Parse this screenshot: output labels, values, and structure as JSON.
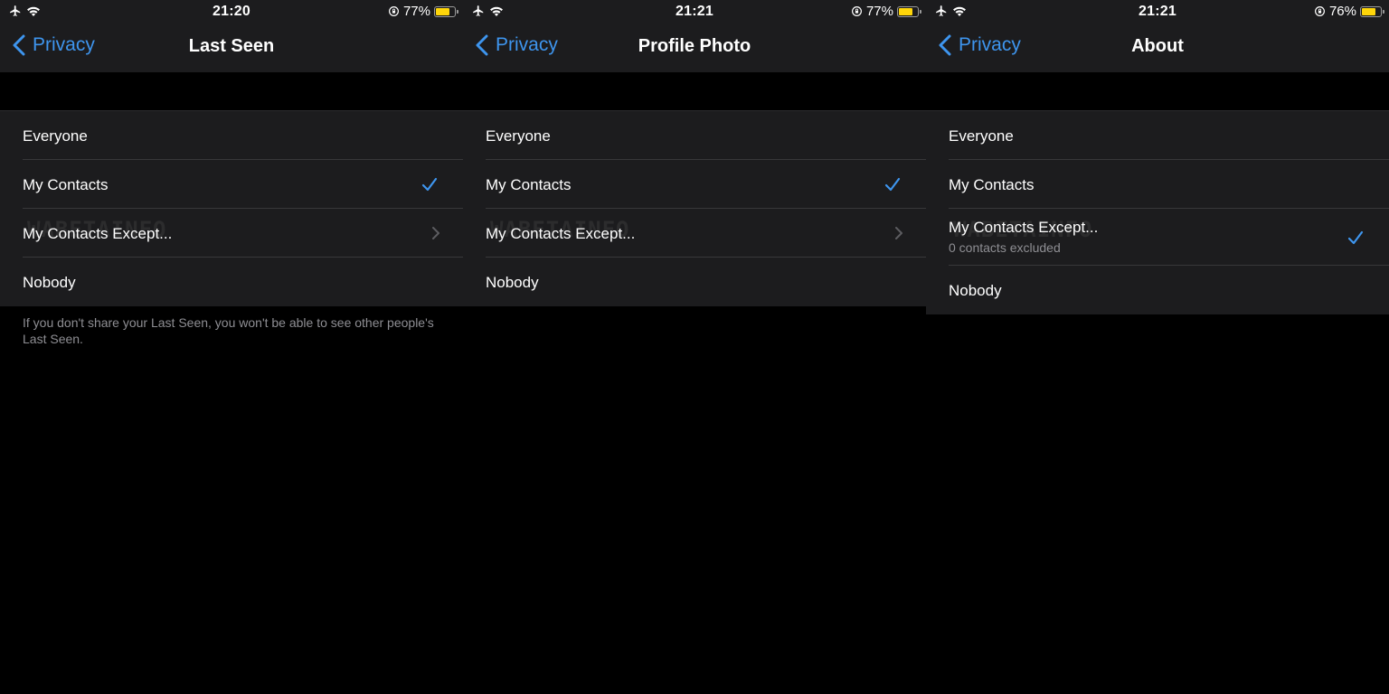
{
  "watermark": "WABETAINFO",
  "screens": [
    {
      "status": {
        "time": "21:20",
        "battery": "77%",
        "battery_level": 0.77
      },
      "back_label": "Privacy",
      "title": "Last Seen",
      "options": [
        {
          "label": "Everyone",
          "sublabel": "",
          "checked": false,
          "chevron": false
        },
        {
          "label": "My Contacts",
          "sublabel": "",
          "checked": true,
          "chevron": false
        },
        {
          "label": "My Contacts Except...",
          "sublabel": "",
          "checked": false,
          "chevron": true
        },
        {
          "label": "Nobody",
          "sublabel": "",
          "checked": false,
          "chevron": false
        }
      ],
      "footer": "If you don't share your Last Seen, you won't be able to see other people's Last Seen."
    },
    {
      "status": {
        "time": "21:21",
        "battery": "77%",
        "battery_level": 0.77
      },
      "back_label": "Privacy",
      "title": "Profile Photo",
      "options": [
        {
          "label": "Everyone",
          "sublabel": "",
          "checked": false,
          "chevron": false
        },
        {
          "label": "My Contacts",
          "sublabel": "",
          "checked": true,
          "chevron": false
        },
        {
          "label": "My Contacts Except...",
          "sublabel": "",
          "checked": false,
          "chevron": true
        },
        {
          "label": "Nobody",
          "sublabel": "",
          "checked": false,
          "chevron": false
        }
      ],
      "footer": ""
    },
    {
      "status": {
        "time": "21:21",
        "battery": "76%",
        "battery_level": 0.76
      },
      "back_label": "Privacy",
      "title": "About",
      "options": [
        {
          "label": "Everyone",
          "sublabel": "",
          "checked": false,
          "chevron": false
        },
        {
          "label": "My Contacts",
          "sublabel": "",
          "checked": false,
          "chevron": false
        },
        {
          "label": "My Contacts Except...",
          "sublabel": "0 contacts excluded",
          "checked": true,
          "chevron": false
        },
        {
          "label": "Nobody",
          "sublabel": "",
          "checked": false,
          "chevron": false
        }
      ],
      "footer": ""
    }
  ],
  "colors": {
    "accent": "#3e95ee",
    "background": "#000000",
    "surface": "#1c1c1e",
    "battery": "#ffd60a"
  },
  "icons": {
    "airplane": "airplane-icon",
    "wifi": "wifi-icon",
    "rotation_lock": "rotation-lock-icon",
    "battery": "battery-icon",
    "back": "chevron-left-icon",
    "check": "check-icon",
    "chevron": "chevron-right-icon"
  }
}
